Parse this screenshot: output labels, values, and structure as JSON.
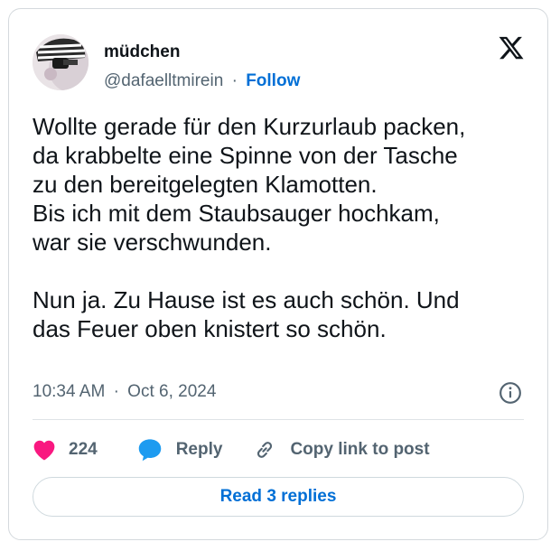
{
  "author": {
    "name": "müdchen",
    "handle": "@dafaelltmirein",
    "separator": "·",
    "follow_label": "Follow"
  },
  "tweet": {
    "text": "Wollte gerade für den Kurzurlaub packen,\nda krabbelte eine Spinne von der Tasche\nzu den bereitgelegten Klamotten.\nBis ich mit dem Staubsauger hochkam,\nwar sie verschwunden.\n\nNun ja. Zu Hause ist es auch schön. Und\ndas Feuer oben knistert so schön.",
    "time": "10:34 AM",
    "separator": "·",
    "date": "Oct 6, 2024"
  },
  "actions": {
    "like_count": "224",
    "reply_label": "Reply",
    "copy_label": "Copy link to post"
  },
  "read_replies_label": "Read 3 replies",
  "icons": {
    "logo": "x-logo-icon",
    "info": "info-icon",
    "like": "heart-icon",
    "reply": "speech-bubble-icon",
    "copy": "link-icon"
  },
  "colors": {
    "link": "#006fd6",
    "heart": "#f91880",
    "reply": "#1d9bf0",
    "secondary_text": "#536471",
    "text": "#0f1419"
  }
}
